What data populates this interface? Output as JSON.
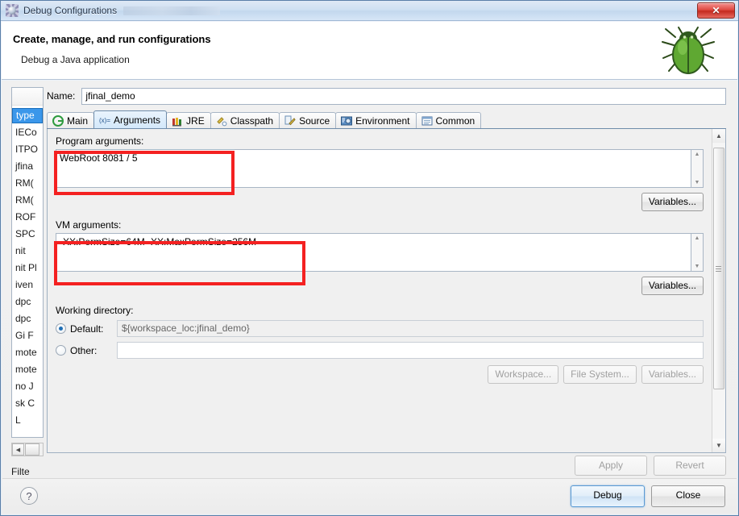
{
  "window": {
    "title": "Debug Configurations",
    "app_icon": "debug-configurations-icon",
    "close_label": "✕"
  },
  "banner": {
    "heading": "Create, manage, and run configurations",
    "subtitle": "Debug a Java application",
    "image": "green-bug-icon"
  },
  "tree": {
    "items": [
      {
        "label": "type",
        "selected": true
      },
      {
        "label": "IECo",
        "selected": false
      },
      {
        "label": "ITPO",
        "selected": false
      },
      {
        "label": "jfina",
        "selected": false
      },
      {
        "label": "RM(",
        "selected": false
      },
      {
        "label": "RM(",
        "selected": false
      },
      {
        "label": "ROF",
        "selected": false
      },
      {
        "label": "SPC",
        "selected": false
      },
      {
        "label": "nit",
        "selected": false
      },
      {
        "label": "nit Pl",
        "selected": false
      },
      {
        "label": "iven",
        "selected": false
      },
      {
        "label": "dpc",
        "selected": false
      },
      {
        "label": "dpc",
        "selected": false
      },
      {
        "label": "Gi F",
        "selected": false
      },
      {
        "label": "mote",
        "selected": false
      },
      {
        "label": "mote",
        "selected": false
      },
      {
        "label": "no J",
        "selected": false
      },
      {
        "label": "sk C",
        "selected": false
      },
      {
        "label": "L",
        "selected": false
      }
    ],
    "filter_label": "Filte"
  },
  "form": {
    "name_label": "Name:",
    "name_value": "jfinal_demo"
  },
  "tabs": [
    {
      "label": "Main",
      "icon": "java-main-icon",
      "active": false
    },
    {
      "label": "Arguments",
      "icon": "arguments-xy-icon",
      "active": true
    },
    {
      "label": "JRE",
      "icon": "jre-library-icon",
      "active": false
    },
    {
      "label": "Classpath",
      "icon": "classpath-icon",
      "active": false
    },
    {
      "label": "Source",
      "icon": "source-pencil-icon",
      "active": false
    },
    {
      "label": "Environment",
      "icon": "environment-icon",
      "active": false
    },
    {
      "label": "Common",
      "icon": "common-window-icon",
      "active": false
    }
  ],
  "arguments_tab": {
    "program_args_label": "Program arguments:",
    "program_args_value": "WebRoot 8081 / 5",
    "program_variables_button": "Variables...",
    "vm_args_label": "VM arguments:",
    "vm_args_value": "-XX:PermSize=64M -XX:MaxPermSize=256M",
    "vm_variables_button": "Variables...",
    "working_directory_label": "Working directory:",
    "default_label": "Default:",
    "default_value": "${workspace_loc:jfinal_demo}",
    "default_selected": true,
    "other_label": "Other:",
    "other_value": "",
    "other_selected": false,
    "workspace_button": "Workspace...",
    "file_system_button": "File System...",
    "variables_button": "Variables..."
  },
  "actions": {
    "apply_label": "Apply",
    "apply_enabled": false,
    "revert_label": "Revert",
    "revert_enabled": false,
    "help_label": "?",
    "debug_label": "Debug",
    "close_label": "Close"
  },
  "annotations": {
    "color": "#f42121",
    "boxes": [
      {
        "name": "program-arguments-highlight"
      },
      {
        "name": "vm-arguments-highlight"
      }
    ]
  }
}
